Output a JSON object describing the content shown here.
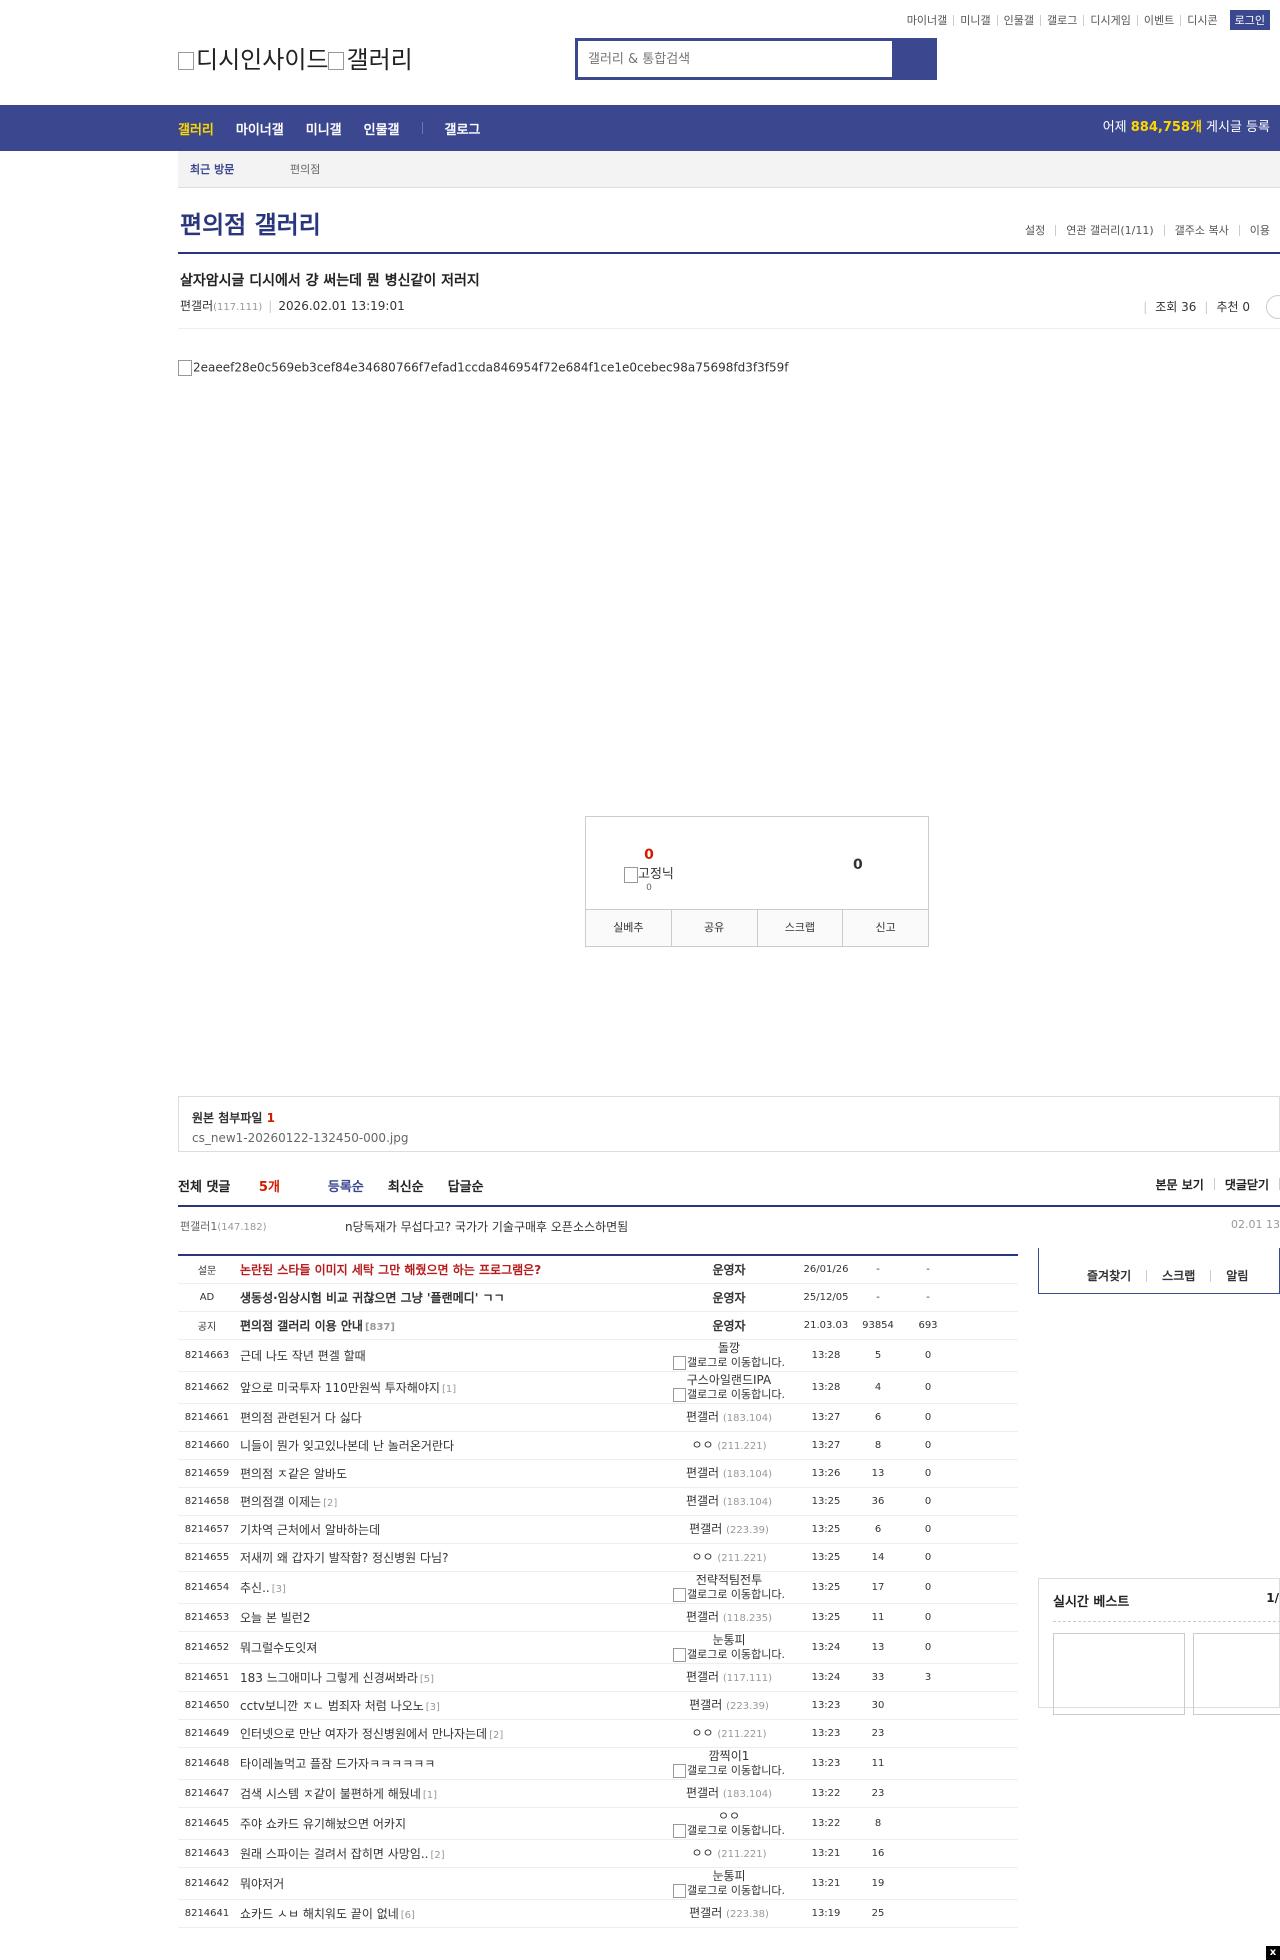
{
  "top_links": [
    "마이너갤",
    "미니갤",
    "인물갤",
    "갤로그",
    "디시게임",
    "이벤트",
    "디시콘"
  ],
  "login_label": "로그인",
  "logo": {
    "alt1": "디시인사이드",
    "alt2": "갤러리"
  },
  "search": {
    "placeholder": "갤러리 & 통합검색"
  },
  "gnb": {
    "items": [
      "갤러리",
      "마이너갤",
      "미니갤",
      "인물갤",
      "갤로그"
    ],
    "count_prefix": "어제 ",
    "count_value": "884,758개",
    "count_suffix": " 게시글 등록"
  },
  "recent": {
    "label": "최근 방문",
    "item": "편의점"
  },
  "gallery": {
    "title": "편의점 갤러리",
    "tools": [
      "설정",
      "연관 갤러리(1/11)",
      "갤주소 복사",
      "이용"
    ]
  },
  "post": {
    "title": "살자암시글 디시에서 걍 써는데 뭔 병신같이 저러지",
    "author": "편갤러",
    "author_ip": "(117.111)",
    "date": "2026.02.01 13:19:01",
    "views_label": "조회 36",
    "recommend_label": "추천 0",
    "image_alt": "2eaeef28e0c569eb3cef84e34680766f7efad1ccda846954f72e684f1ce1e0cebec98a75698fd3f3f59f"
  },
  "recommend": {
    "up_count": "0",
    "fixed_label": "고정닉",
    "fixed_count": "0",
    "down_count": "0",
    "buttons": [
      "실베추",
      "공유",
      "스크랩",
      "신고"
    ]
  },
  "attachment": {
    "label": "원본 첨부파일",
    "count": "1",
    "filename": "cs_new1-20260122-132450-000.jpg"
  },
  "comments": {
    "total_label": "전체 댓글",
    "total_count": "5개",
    "sort": [
      "등록순",
      "최신순",
      "답글순"
    ],
    "right": [
      "본문 보기",
      "댓글닫기"
    ],
    "first": {
      "name": "편갤러1",
      "ip": "(147.182)",
      "text": "n당독재가 무섭다고? 국가가 기술구매후 오픈소스하면됨",
      "date": "02.01 13"
    }
  },
  "list": [
    {
      "no": "설문",
      "title": "논란된 스타들 이미지 세탁 그만 해줬으면 하는 프로그램은?",
      "writer": "운영자",
      "date": "26/01/26",
      "views": "-",
      "rec": "-",
      "notice": true,
      "red": true
    },
    {
      "no": "AD",
      "title": "생동성·임상시험 비교 귀찮으면 그냥 '플랜메디' ㄱㄱ",
      "writer": "운영자",
      "date": "25/12/05",
      "views": "-",
      "rec": "-",
      "notice": true
    },
    {
      "no": "공지",
      "title": "편의점 갤러리 이용 안내",
      "rc": "[837]",
      "writer": "운영자",
      "date": "21.03.03",
      "views": "93854",
      "rec": "693",
      "notice": true
    },
    {
      "no": "8214663",
      "title": "근데 나도 작년 편겔 할때",
      "writer": "돌깡",
      "gallog": "갤로그로 이동합니다.",
      "date": "13:28",
      "views": "5",
      "rec": "0"
    },
    {
      "no": "8214662",
      "title": "앞으로 미국투자 110만원씩 투자해야지",
      "rc": "[1]",
      "writer": "구스아일랜드IPA",
      "gallog": "갤로그로 이동합니다.",
      "date": "13:28",
      "views": "4",
      "rec": "0"
    },
    {
      "no": "8214661",
      "title": "편의점 관련된거 다 싫다",
      "writer": "편갤러",
      "ip": "(183.104)",
      "date": "13:27",
      "views": "6",
      "rec": "0"
    },
    {
      "no": "8214660",
      "title": "니들이 뭔가 잊고있나본데 난 놀러온거란다",
      "writer": "ㅇㅇ",
      "ip": "(211.221)",
      "date": "13:27",
      "views": "8",
      "rec": "0"
    },
    {
      "no": "8214659",
      "title": "편의점 ㅈ같은 알바도",
      "writer": "편갤러",
      "ip": "(183.104)",
      "date": "13:26",
      "views": "13",
      "rec": "0"
    },
    {
      "no": "8214658",
      "title": "편의점갤 이제는",
      "rc": "[2]",
      "writer": "편갤러",
      "ip": "(183.104)",
      "date": "13:25",
      "views": "36",
      "rec": "0"
    },
    {
      "no": "8214657",
      "title": "기차역 근처에서 알바하는데",
      "writer": "편갤러",
      "ip": "(223.39)",
      "date": "13:25",
      "views": "6",
      "rec": "0"
    },
    {
      "no": "8214655",
      "title": "저새끼 왜 갑자기 발작함? 정신병원 다님?",
      "writer": "ㅇㅇ",
      "ip": "(211.221)",
      "date": "13:25",
      "views": "14",
      "rec": "0"
    },
    {
      "no": "8214654",
      "title": "추신..",
      "rc": "[3]",
      "writer": "전략적팀전투",
      "gallog": "갤로그로 이동합니다.",
      "date": "13:25",
      "views": "17",
      "rec": "0"
    },
    {
      "no": "8214653",
      "title": "오늘 본 빌런2",
      "writer": "편갤러",
      "ip": "(118.235)",
      "date": "13:25",
      "views": "11",
      "rec": "0"
    },
    {
      "no": "8214652",
      "title": "뭐그럴수도잇져",
      "writer": "눈통피",
      "gallog": "갤로그로 이동합니다.",
      "date": "13:24",
      "views": "13",
      "rec": "0"
    },
    {
      "no": "8214651",
      "title": "183 느그애미나 그렇게 신경써봐라",
      "rc": "[5]",
      "writer": "편갤러",
      "ip": "(117.111)",
      "date": "13:24",
      "views": "33",
      "rec": "3"
    },
    {
      "no": "8214650",
      "title": "cctv보니깐 ㅈㄴ 범죄자 처럼 나오노",
      "rc": "[3]",
      "writer": "편갤러",
      "ip": "(223.39)",
      "date": "13:23",
      "views": "30",
      "rec": ""
    },
    {
      "no": "8214649",
      "title": "인터넷으로 만난 여자가 정신병원에서 만나자는데",
      "rc": "[2]",
      "writer": "ㅇㅇ",
      "ip": "(211.221)",
      "date": "13:23",
      "views": "23",
      "rec": ""
    },
    {
      "no": "8214648",
      "title": "타이레놀먹고 플잠 드가자ㅋㅋㅋㅋㅋㅋ",
      "writer": "깜찍이1",
      "gallog": "갤로그로 이동합니다.",
      "date": "13:23",
      "views": "11",
      "rec": ""
    },
    {
      "no": "8214647",
      "title": "검색 시스템 ㅈ같이 불편하게 해뒀네",
      "rc": "[1]",
      "writer": "편갤러",
      "ip": "(183.104)",
      "date": "13:22",
      "views": "23",
      "rec": ""
    },
    {
      "no": "8214645",
      "title": "주야 쇼카드 유기해놨으면 어카지",
      "writer": "ㅇㅇ",
      "gallog": "갤로그로 이동합니다.",
      "date": "13:22",
      "views": "8",
      "rec": ""
    },
    {
      "no": "8214643",
      "title": "원래 스파이는 걸려서 잡히면 사망임..",
      "rc": "[2]",
      "writer": "ㅇㅇ",
      "ip": "(211.221)",
      "date": "13:21",
      "views": "16",
      "rec": ""
    },
    {
      "no": "8214642",
      "title": "뭐야저거",
      "writer": "눈통피",
      "gallog": "갤로그로 이동합니다.",
      "date": "13:21",
      "views": "19",
      "rec": ""
    },
    {
      "no": "8214641",
      "title": "쇼카드 ㅅㅂ 해치워도 끝이 없네",
      "rc": "[6]",
      "writer": "편갤러",
      "ip": "(223.38)",
      "date": "13:19",
      "views": "25",
      "rec": ""
    }
  ],
  "side": {
    "buttons": [
      "즐겨찾기",
      "스크랩",
      "알림"
    ],
    "realtime_title": "실시간 베스트",
    "realtime_page": "1/"
  },
  "close_label": "x"
}
